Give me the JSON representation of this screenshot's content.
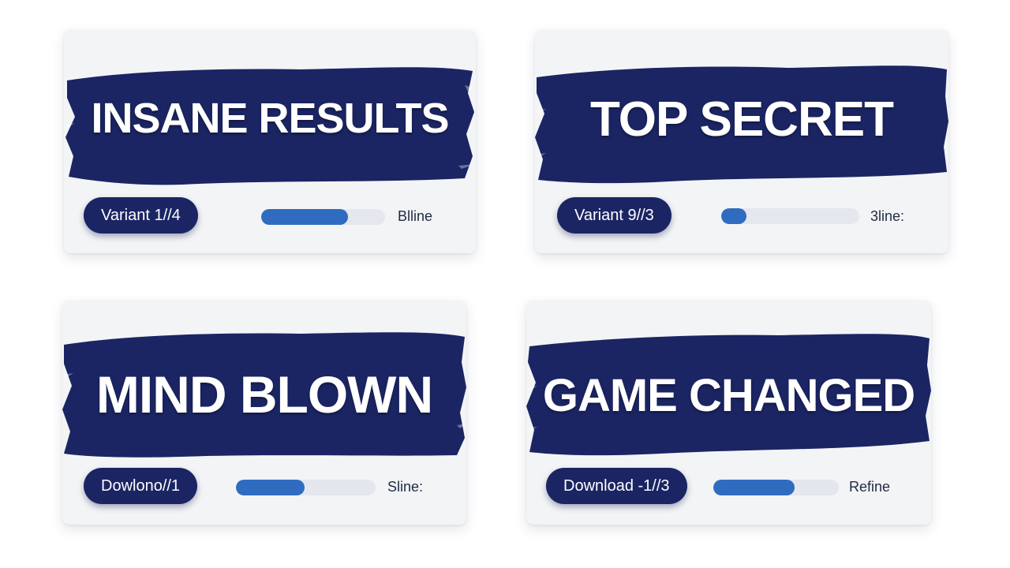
{
  "colors": {
    "brush": "#1b2563",
    "pill": "#1b2563",
    "progress_fill": "#2f6cc0",
    "progress_track": "#e4e7ee",
    "card_bg": "#f3f4f6"
  },
  "cards": [
    {
      "headline": "INSANE RESULTS",
      "button_label": "Variant 1//4",
      "progress": 0.7,
      "side_label": "Blline"
    },
    {
      "headline": "TOP SECRET",
      "button_label": "Variant 9//3",
      "progress": 0.18,
      "side_label": "3line:"
    },
    {
      "headline": "MIND BLOWN",
      "button_label": "Dowlono//1",
      "progress": 0.49,
      "side_label": "Sline:"
    },
    {
      "headline": "GAME CHANGED",
      "button_label": "Download -1//3",
      "progress": 0.65,
      "side_label": "Refine"
    }
  ]
}
